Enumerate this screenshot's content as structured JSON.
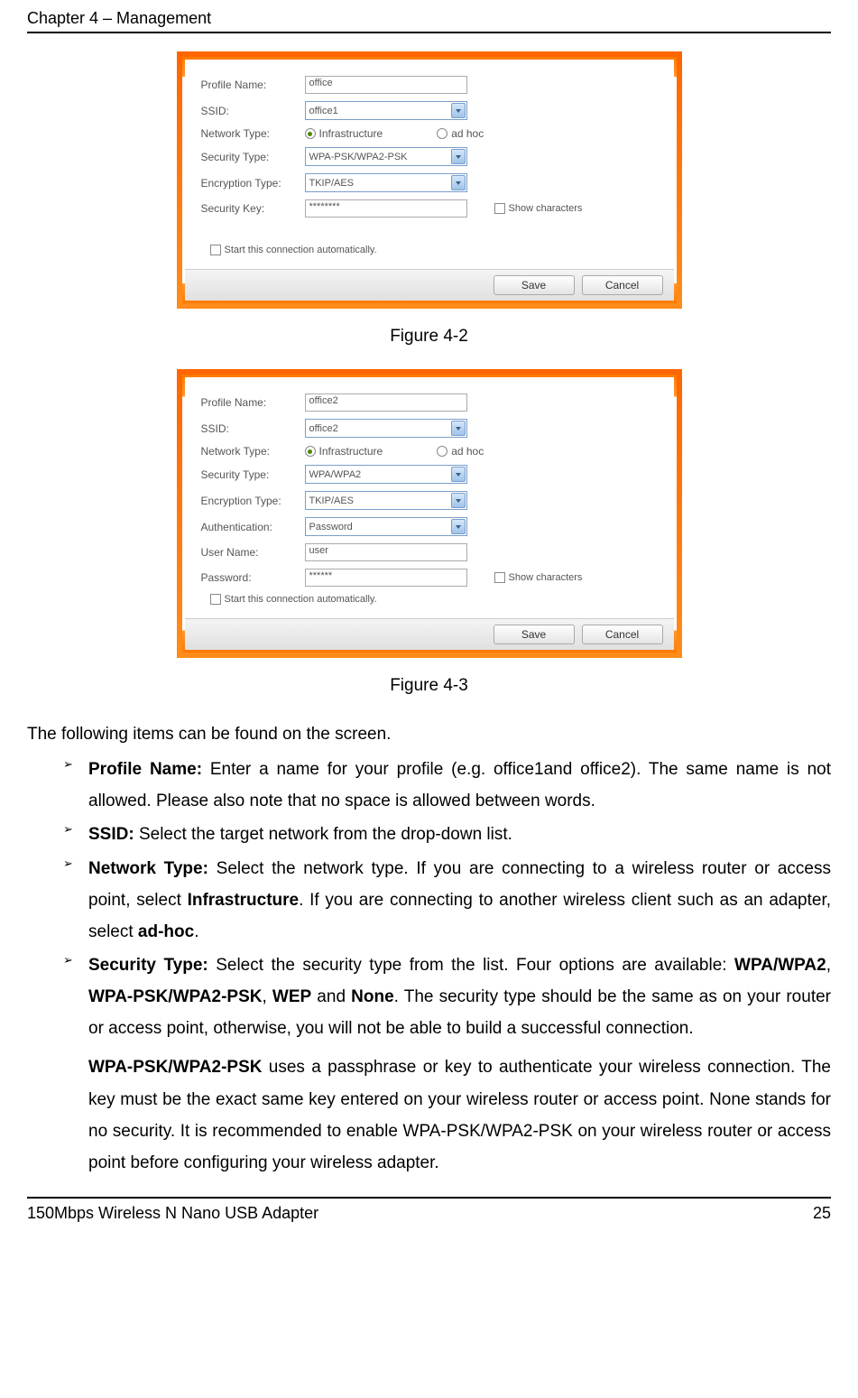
{
  "header": {
    "title": "Chapter 4 – Management"
  },
  "footer": {
    "product": "150Mbps Wireless N Nano USB Adapter",
    "page": "25"
  },
  "dialog1": {
    "labels": {
      "profile_name": "Profile Name:",
      "ssid": "SSID:",
      "network_type": "Network Type:",
      "security_type": "Security Type:",
      "encryption_type": "Encryption Type:",
      "security_key": "Security Key:"
    },
    "values": {
      "profile_name": "office",
      "ssid": "office1",
      "security_type": "WPA-PSK/WPA2-PSK",
      "encryption_type": "TKIP/AES",
      "security_key": "********"
    },
    "radio": {
      "infrastructure": "Infrastructure",
      "adhoc": "ad hoc"
    },
    "show_chars": "Show characters",
    "auto_connect": "Start this connection automatically.",
    "buttons": {
      "save": "Save",
      "cancel": "Cancel"
    }
  },
  "dialog2": {
    "labels": {
      "profile_name": "Profile Name:",
      "ssid": "SSID:",
      "network_type": "Network Type:",
      "security_type": "Security Type:",
      "encryption_type": "Encryption Type:",
      "authentication": "Authentication:",
      "user_name": "User Name:",
      "password": "Password:"
    },
    "values": {
      "profile_name": "office2",
      "ssid": "office2",
      "security_type": "WPA/WPA2",
      "encryption_type": "TKIP/AES",
      "authentication": "Password",
      "user_name": "user",
      "password": "******"
    },
    "radio": {
      "infrastructure": "Infrastructure",
      "adhoc": "ad hoc"
    },
    "show_chars": "Show characters",
    "auto_connect": "Start this connection automatically.",
    "buttons": {
      "save": "Save",
      "cancel": "Cancel"
    }
  },
  "captions": {
    "fig42": "Figure 4-2",
    "fig43": "Figure 4-3"
  },
  "text": {
    "intro": "The following items can be found on the screen.",
    "li1_label": "Profile Name: ",
    "li1_body": "Enter a name for your profile (e.g. office1and office2). The same name is not allowed. Please also note that no space is allowed between words.",
    "li2_label": "SSID: ",
    "li2_body": "Select the target network from the drop-down list.",
    "li3_label": "Network Type: ",
    "li3_body_a": "Select the network type. If you are connecting to a wireless router or access point, select ",
    "li3_bold_a": "Infrastructure",
    "li3_body_b": ". If you are connecting to another wireless client such as an adapter, select ",
    "li3_bold_b": "ad-hoc",
    "li3_body_c": ".",
    "li4_label": "Security Type: ",
    "li4_body_a": "Select the security type from the list. Four options are available: ",
    "li4_bold_a": "WPA/WPA2",
    "li4_sep1": ", ",
    "li4_bold_b": "WPA-PSK/WPA2-PSK",
    "li4_sep2": ", ",
    "li4_bold_c": "WEP",
    "li4_sep3": " and ",
    "li4_bold_d": "None",
    "li4_body_b": ". The security type should be the same as on your router or access point, otherwise, you will not be able to build a successful connection.",
    "sub_bold": "WPA-PSK/WPA2-PSK",
    "sub_body": " uses a passphrase or key to authenticate your wireless connection. The key must be the exact same key entered on your wireless router or access point. None stands for no security. It is recommended to enable WPA-PSK/WPA2-PSK on your wireless router or access point before configuring your wireless adapter."
  }
}
